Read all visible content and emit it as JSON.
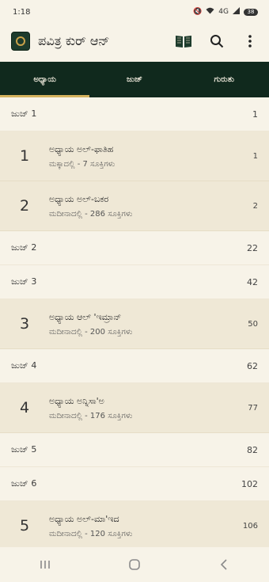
{
  "status": {
    "time": "1:18",
    "network": "4G",
    "battery": "38"
  },
  "app": {
    "title": "ಪವಿತ್ರ ಕುರ್ ಆನ್"
  },
  "tabs": [
    {
      "label": "ಅಧ್ಯಾಯ",
      "active": true
    },
    {
      "label": "ಜುಜ್",
      "active": false
    },
    {
      "label": "ಗುರುತು",
      "active": false
    }
  ],
  "rows": [
    {
      "kind": "juz",
      "label": "ಜುಜ್ 1",
      "page": "1"
    },
    {
      "kind": "chapter",
      "number": "1",
      "name": "ಅಧ್ಯಾಯ ಅಲ್-ಫಾತಿಹ",
      "sub": "ಮಕ್ಕಾದಲ್ಲಿ - 7 ಸೂಕ್ತಿಗಳು",
      "page": "1"
    },
    {
      "kind": "chapter",
      "number": "2",
      "name": "ಅಧ್ಯಾಯ ಅಲ್-ಬಕರ",
      "sub": "ಮದೀನಾದಲ್ಲಿ - 286 ಸೂಕ್ತಿಗಳು",
      "page": "2"
    },
    {
      "kind": "juz",
      "label": "ಜುಜ್ 2",
      "page": "22"
    },
    {
      "kind": "juz",
      "label": "ಜುಜ್ 3",
      "page": "42"
    },
    {
      "kind": "chapter",
      "number": "3",
      "name": "ಅಧ್ಯಾಯ ಆಲ್ 'ಇಮ್ರಾನ್",
      "sub": "ಮದೀನಾದಲ್ಲಿ - 200 ಸೂಕ್ತಿಗಳು",
      "page": "50"
    },
    {
      "kind": "juz",
      "label": "ಜುಜ್ 4",
      "page": "62"
    },
    {
      "kind": "chapter",
      "number": "4",
      "name": "ಅಧ್ಯಾಯ ಅನ್ನಿಸಾ'ಅ",
      "sub": "ಮದೀನಾದಲ್ಲಿ - 176 ಸೂಕ್ತಿಗಳು",
      "page": "77"
    },
    {
      "kind": "juz",
      "label": "ಜುಜ್ 5",
      "page": "82"
    },
    {
      "kind": "juz",
      "label": "ಜುಜ್ 6",
      "page": "102"
    },
    {
      "kind": "chapter",
      "number": "5",
      "name": "ಅಧ್ಯಾಯ ಅಲ್-ಮಾ'ಇದ",
      "sub": "ಮದೀನಾದಲ್ಲಿ - 120 ಸೂಕ್ತಿಗಳು",
      "page": "106"
    }
  ],
  "icons": {
    "logo": "quran-logo-icon",
    "read": "open-book-icon",
    "search": "search-icon",
    "more": "more-vert-icon",
    "recents": "recents-icon",
    "home": "home-icon",
    "back": "back-icon"
  },
  "colors": {
    "tab_bar": "#10291d",
    "tab_indicator": "#d4b25e",
    "chapter_bg": "#efe8d6",
    "page_bg": "#f7f3e8"
  }
}
